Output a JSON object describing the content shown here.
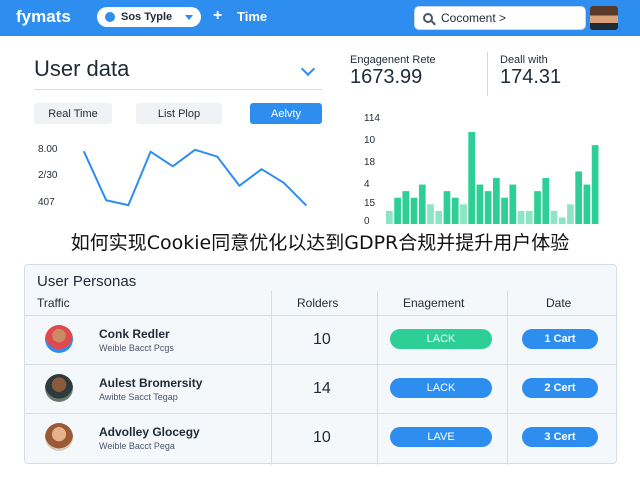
{
  "topbar": {
    "brand": "fymats",
    "pill_label": "Sos Typle",
    "plus_icon": "+",
    "time_label": "Time",
    "search_value": "Cocoment >"
  },
  "user_data": {
    "title": "User data",
    "tabs": [
      "Real Time",
      "List Plop",
      "Aelvty"
    ],
    "active_tab": 2,
    "y_ticks": [
      "8.00",
      "2/30",
      "407"
    ],
    "line_values": [
      0.6,
      0.1,
      0.05,
      0.6,
      0.45,
      0.62,
      0.55,
      0.25,
      0.42,
      0.28,
      0.05
    ]
  },
  "metrics": {
    "engagement_label": "Engagenent Rete",
    "engagement_value": "1673.99",
    "deal_label": "Deall with",
    "deal_value": "174.31",
    "y_ticks": [
      "114",
      "10",
      "18",
      "4",
      "15",
      "0"
    ],
    "bar_values": [
      2,
      4,
      5,
      4,
      6,
      3,
      2,
      5,
      4,
      3,
      14,
      6,
      5,
      7,
      4,
      6,
      2,
      2,
      5,
      7,
      2,
      1,
      3,
      8,
      6,
      12
    ],
    "bar_color": "#2ecf97"
  },
  "banner": "如何实现Cookie同意优化以达到GDPR合规并提升用户体验",
  "personas": {
    "title": "User Personas",
    "headers": [
      "Traffic",
      "Rolders",
      "Enagement",
      "Date"
    ],
    "rows": [
      {
        "name": "Conk Redler",
        "sub": "Weible Bacct Pcgs",
        "count": "10",
        "engagement": "LACK",
        "eng_color": "#2ecf97",
        "date": "1 Cart"
      },
      {
        "name": "Aulest Bromersity",
        "sub": "Awibte Sacct Tegap",
        "count": "14",
        "engagement": "LACK",
        "eng_color": "#2d8ef0",
        "date": "2 Cert"
      },
      {
        "name": "Advolley Glocegy",
        "sub": "Weible Bacct Pega",
        "count": "10",
        "engagement": "LAVE",
        "eng_color": "#2d8ef0",
        "date": "3 Cert"
      }
    ]
  },
  "colors": {
    "accent": "#2d8ef0",
    "positive": "#2ecf97"
  }
}
